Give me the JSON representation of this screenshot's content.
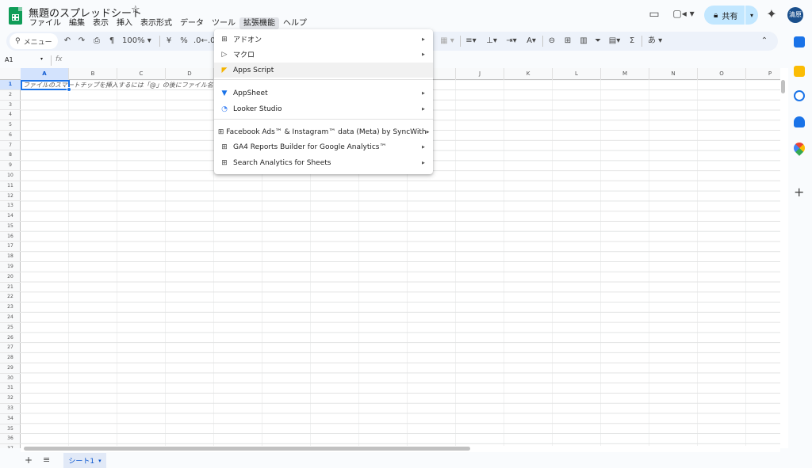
{
  "app": {
    "title": "無題のスプレッドシート"
  },
  "menubar": {
    "items": [
      "ファイル",
      "編集",
      "表示",
      "挿入",
      "表示形式",
      "データ",
      "ツール",
      "拡張機能",
      "ヘルプ"
    ],
    "active_index": 7
  },
  "header": {
    "share_label": "共有",
    "avatar_initials": "清原"
  },
  "toolbar": {
    "search_label": "メニュー",
    "zoom": "100%",
    "currency": "¥",
    "percent": "%",
    "decimal_decrease": ".0",
    "sum": "Σ",
    "input_tools": "あ"
  },
  "formula_bar": {
    "cell_ref": "A1",
    "fx": "fx"
  },
  "grid": {
    "columns": [
      "A",
      "B",
      "C",
      "D",
      "E",
      "F",
      "G",
      "H",
      "I",
      "J",
      "K",
      "L",
      "M",
      "N",
      "O",
      "P"
    ],
    "rows": [
      "1",
      "2",
      "3",
      "4",
      "5",
      "6",
      "7",
      "8",
      "9",
      "10",
      "11",
      "12",
      "13",
      "14",
      "15",
      "16",
      "17",
      "18",
      "19",
      "20",
      "21",
      "22",
      "23",
      "24",
      "25",
      "26",
      "27",
      "28",
      "29",
      "30",
      "31",
      "32",
      "33",
      "34",
      "35",
      "36",
      "37"
    ],
    "selected_cell": "A1",
    "a1_hint": "ファイルのスマートチップを挿入するには「@」の後にファイル名"
  },
  "sheet_tabs": {
    "active": "シート1"
  },
  "ext_menu": {
    "items": [
      {
        "label": "アドオン",
        "icon": "add-on-icon",
        "submenu": true
      },
      {
        "label": "マクロ",
        "icon": "macro-play-icon",
        "submenu": true
      },
      {
        "label": "Apps Script",
        "icon": "apps-script-icon",
        "submenu": false
      },
      {
        "label": "AppSheet",
        "icon": "appsheet-icon",
        "submenu": true
      },
      {
        "label": "Looker Studio",
        "icon": "looker-studio-icon",
        "submenu": true
      },
      {
        "label": "Facebook Ads™ & Instagram™ data (Meta) by SyncWith",
        "icon": "add-on-icon",
        "submenu": true
      },
      {
        "label": "GA4 Reports Builder for Google Analytics™",
        "icon": "add-on-icon",
        "submenu": true
      },
      {
        "label": "Search Analytics for Sheets",
        "icon": "add-on-icon",
        "submenu": true
      }
    ]
  },
  "colors": {
    "accent": "#1a73e8",
    "share_bg": "#c2e7ff",
    "sheets_green": "#0f9d58",
    "selection_bg": "#d3e3fd"
  }
}
